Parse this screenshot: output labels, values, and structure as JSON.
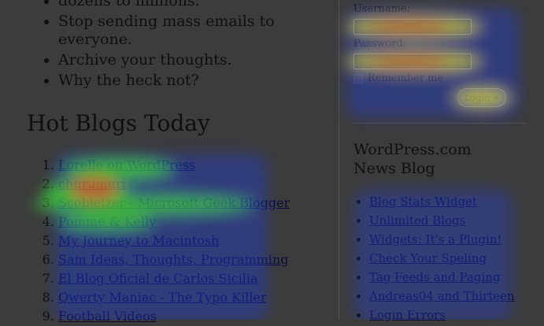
{
  "main": {
    "bullets": [
      "dozens to millions.",
      "Stop sending mass emails to everyone.",
      "Archive your thoughts.",
      "Why the heck not?"
    ],
    "hot_title": "Hot Blogs Today",
    "hot_blogs": [
      "Lorelle on WordPress",
      "churumuri",
      "Scobleizer - Microsoft Geek Blogger",
      "Pomme & Kelly",
      "My Journey to Macintosh",
      "Sam Ideas, Thoughts, Programming",
      "El Blog Oficial de Carlos Sicilia",
      "Qwerty Maniac - The Typo Killer",
      "Football Videos"
    ]
  },
  "sidebar": {
    "username_label": "Username:",
    "password_label": "Password:",
    "remember_label": "Remember me",
    "login_label": "Login »",
    "news_title": "WordPress.com News Blog",
    "news_items": [
      "Blog Stats Widget",
      "Unlimited Blogs",
      "Widgets: It's a Plugin!",
      "Check Your Speling",
      "Tag Feeds and Paging",
      "Andreas04 and Thirteen",
      "Login Errors"
    ]
  },
  "colors": {
    "background": "#3c3c3c",
    "link": "#0b0b3a"
  }
}
